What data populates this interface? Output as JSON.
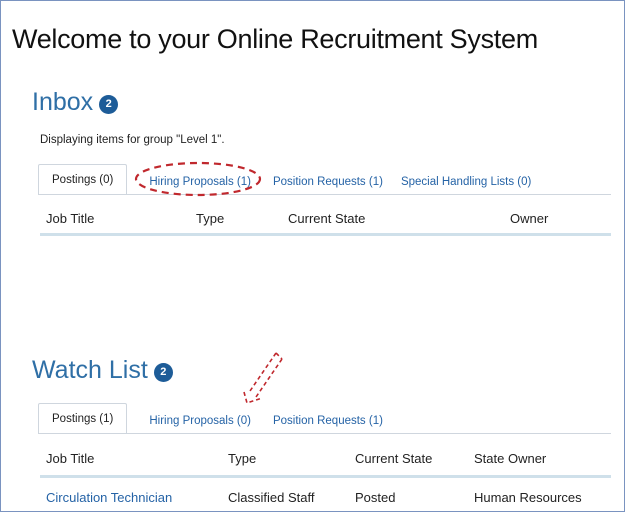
{
  "page_title": "Welcome to your Online Recruitment System",
  "inbox": {
    "label": "Inbox",
    "badge": "2",
    "group_note": "Displaying items for group \"Level 1\".",
    "tabs": [
      "Postings (0)",
      "Hiring Proposals (1)",
      "Position Requests (1)",
      "Special Handling Lists (0)"
    ],
    "columns": [
      "Job Title",
      "Type",
      "Current State",
      "Owner"
    ]
  },
  "watch_list": {
    "label": "Watch List",
    "badge": "2",
    "tabs": [
      "Postings (1)",
      "Hiring Proposals (0)",
      "Position Requests (1)"
    ],
    "columns": [
      "Job Title",
      "Type",
      "Current State",
      "State Owner"
    ],
    "rows": [
      {
        "job_title": "Circulation Technician",
        "type": "Classified Staff",
        "current_state": "Posted",
        "state_owner": "Human Resources"
      }
    ]
  },
  "annotation_color": "#c0282d"
}
